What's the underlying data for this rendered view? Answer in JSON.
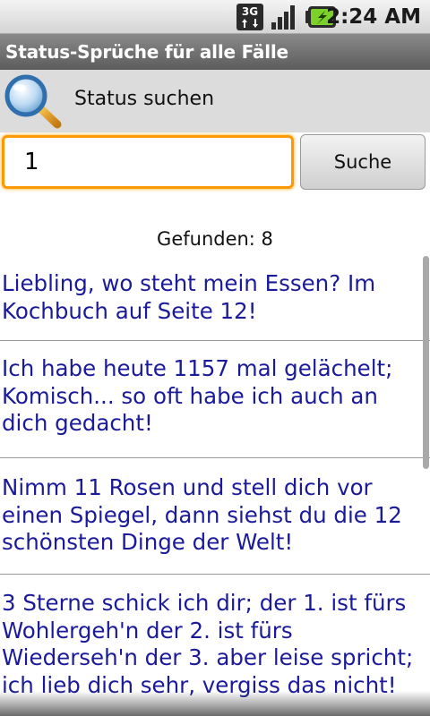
{
  "status_bar": {
    "network_icon": "3g-data-icon",
    "signal_icon": "signal-strength-icon",
    "battery_icon": "battery-charging-icon",
    "time": "2:24 AM"
  },
  "app": {
    "title": "Status-Sprüche für alle Fälle"
  },
  "search_header": {
    "icon": "magnifier-icon",
    "label": "Status suchen"
  },
  "search": {
    "input_value": "1",
    "button_label": "Suche"
  },
  "results": {
    "count_text": "Gefunden: 8",
    "items": [
      "Liebling, wo steht mein Essen? Im Kochbuch auf Seite 12!",
      "Ich habe heute 1157 mal gelächelt; Komisch... so oft habe ich auch an dich gedacht!",
      "Nimm 11 Rosen und stell dich vor einen Spiegel, dann siehst du die 12 schönsten Dinge der Welt!",
      "3 Sterne schick ich dir; der 1. ist fürs Wohlergeh'n der 2. ist fürs Wiederseh'n der 3. aber leise spricht; ich lieb dich sehr, vergiss das nicht!"
    ]
  },
  "colors": {
    "title_bar": "#6e6e6e",
    "input_focus": "#ff9900",
    "result_text": "#1a1a9a"
  }
}
